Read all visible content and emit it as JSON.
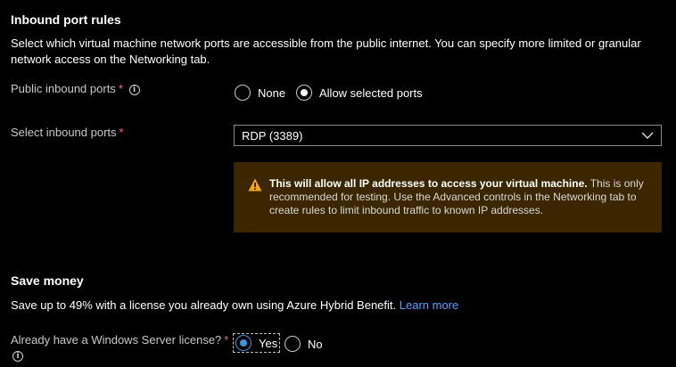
{
  "inbound": {
    "heading": "Inbound port rules",
    "description": "Select which virtual machine network ports are accessible from the public internet. You can specify more limited or granular network access on the Networking tab.",
    "public_label": "Public inbound ports",
    "required_mark": "*",
    "info_glyph": "i",
    "options": [
      "None",
      "Allow selected ports"
    ],
    "selected_option": "Allow selected ports",
    "select_label": "Select inbound ports",
    "select_value": "RDP (3389)",
    "warning_bold": "This will allow all IP addresses to access your virtual machine.",
    "warning_rest": " This is only recommended for testing.  Use the Advanced controls in the Networking tab to create rules to limit inbound traffic to known IP addresses."
  },
  "save": {
    "heading": "Save money",
    "description": "Save up to 49% with a license you already own using Azure Hybrid Benefit.",
    "learn_more": "Learn more",
    "license_label": "Already have a Windows Server license?",
    "required_mark": "*",
    "info_glyph": "i",
    "options": [
      "Yes",
      "No"
    ],
    "selected_option": "Yes"
  },
  "colors": {
    "warning_bg": "#3b2600",
    "warning_icon": "#f7a600",
    "link": "#4ea0ff",
    "required": "#f1707b",
    "radio_accent": "#3a96dd"
  }
}
